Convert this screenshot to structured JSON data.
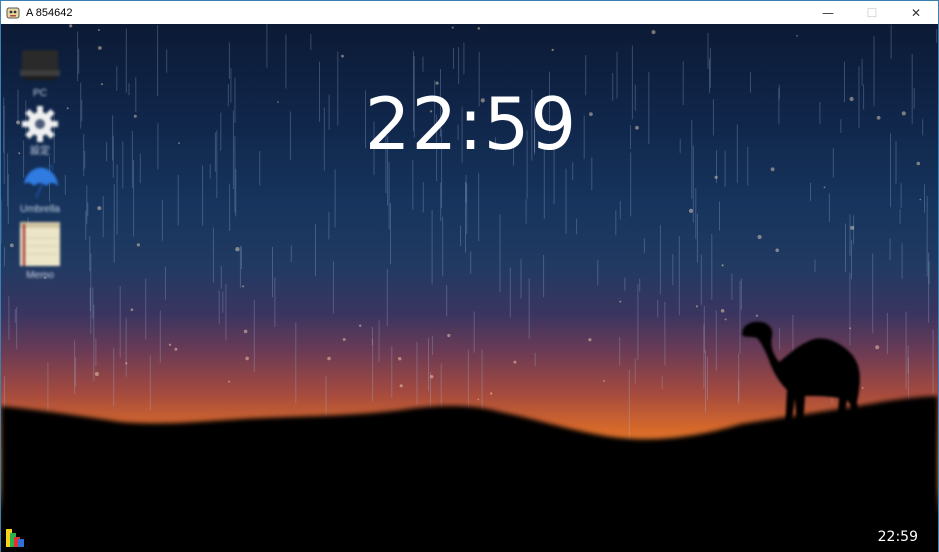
{
  "window": {
    "title": "A 854642",
    "controls": {
      "minimize": "—",
      "maximize": "☐",
      "close": "✕"
    }
  },
  "desktop": {
    "clock_big": "22:59",
    "clock_small": "22:59",
    "icons": [
      {
        "label": "PC",
        "icon": "computer-icon"
      },
      {
        "label": "設定",
        "icon": "gear-icon"
      },
      {
        "label": "Umbrella",
        "icon": "umbrella-icon"
      },
      {
        "label": "Memo",
        "icon": "notepad-icon"
      }
    ]
  },
  "colors": {
    "sky_top": "#0c1a35",
    "sunset": "#e5892a",
    "ground": "#000000",
    "title_border": "#3c7fb1"
  }
}
